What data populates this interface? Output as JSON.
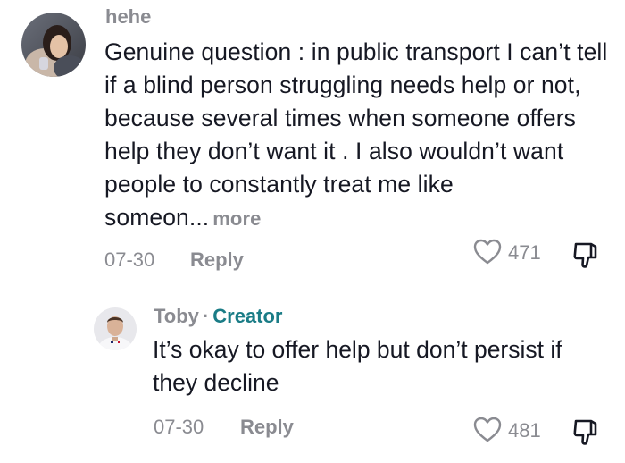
{
  "comments": [
    {
      "username": "hehe",
      "text": "Genuine question : in public transport I can’t tell if a blind person struggling needs help or not, because several times when someone offers help they don’t want it . I also wouldn’t want people to constantly treat me like someon...",
      "more_label": "more",
      "date": "07-30",
      "reply_label": "Reply",
      "likes": "471",
      "avatar_icon": "user-avatar-photo",
      "like_icon": "heart-outline-icon",
      "dislike_icon": "thumbs-down-outline-icon"
    },
    {
      "username": "Toby",
      "separator": "·",
      "badge": "Creator",
      "text": "It’s okay to offer help but don’t persist if they decline",
      "date": "07-30",
      "reply_label": "Reply",
      "likes": "481",
      "avatar_icon": "user-avatar-photo",
      "like_icon": "heart-outline-icon",
      "dislike_icon": "thumbs-down-outline-icon"
    }
  ],
  "colors": {
    "text_primary": "#161823",
    "text_secondary": "#8a8b91",
    "creator_badge": "#1a7c86",
    "background": "#ffffff"
  }
}
